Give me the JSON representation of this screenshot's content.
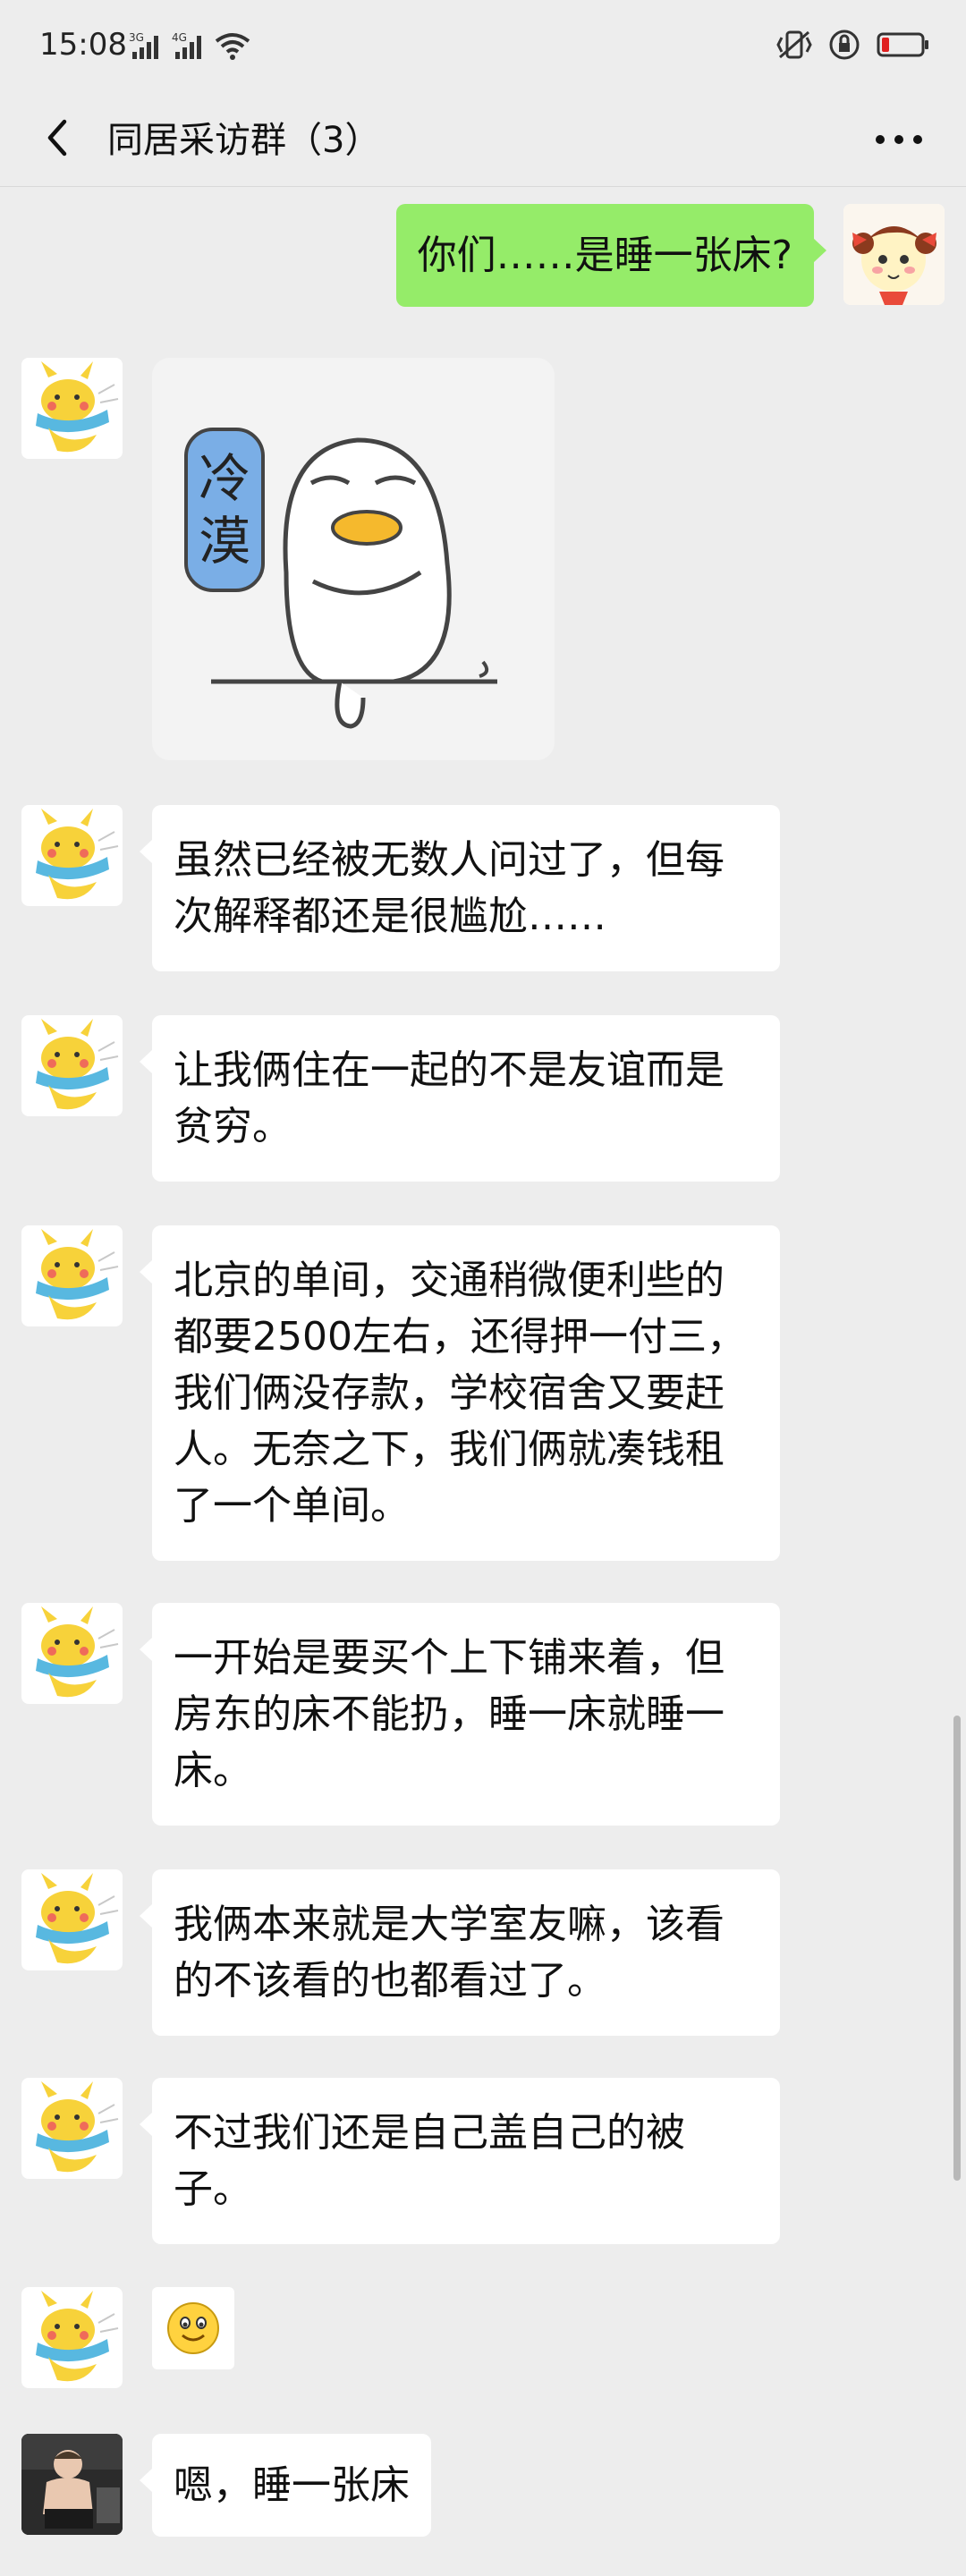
{
  "status_bar": {
    "time": "15:08",
    "signal1_label": "3G",
    "signal2_label": "4G"
  },
  "nav": {
    "title": "同居采访群（3）"
  },
  "colors": {
    "background": "#ededed",
    "outgoing_bubble": "#95ec69",
    "incoming_bubble": "#ffffff",
    "battery_low": "#e02020"
  },
  "messages": [
    {
      "side": "right",
      "type": "text",
      "text": "你们……是睡一张床?"
    },
    {
      "side": "left",
      "type": "sticker",
      "sticker_text": "冷漠",
      "icon": "duck-sticker"
    },
    {
      "side": "left",
      "type": "text",
      "text": "虽然已经被无数人问过了，但每次解释都还是很尴尬……"
    },
    {
      "side": "left",
      "type": "text",
      "text": "让我俩住在一起的不是友谊而是贫穷。"
    },
    {
      "side": "left",
      "type": "text",
      "text": "北京的单间，交通稍微便利些的都要2500左右，还得押一付三，我们俩没存款，学校宿舍又要赶人。无奈之下，我们俩就凑钱租了一个单间。"
    },
    {
      "side": "left",
      "type": "text",
      "text": "一开始是要买个上下铺来着，但房东的床不能扔，睡一床就睡一床。"
    },
    {
      "side": "left",
      "type": "text",
      "text": "我俩本来就是大学室友嘛，该看的不该看的也都看过了。"
    },
    {
      "side": "left",
      "type": "text",
      "text": "不过我们还是自己盖自己的被子。"
    },
    {
      "side": "left",
      "type": "emoji",
      "icon": "smile-emoji"
    },
    {
      "side": "left",
      "type": "text",
      "text": "嗯，睡一张床"
    }
  ]
}
